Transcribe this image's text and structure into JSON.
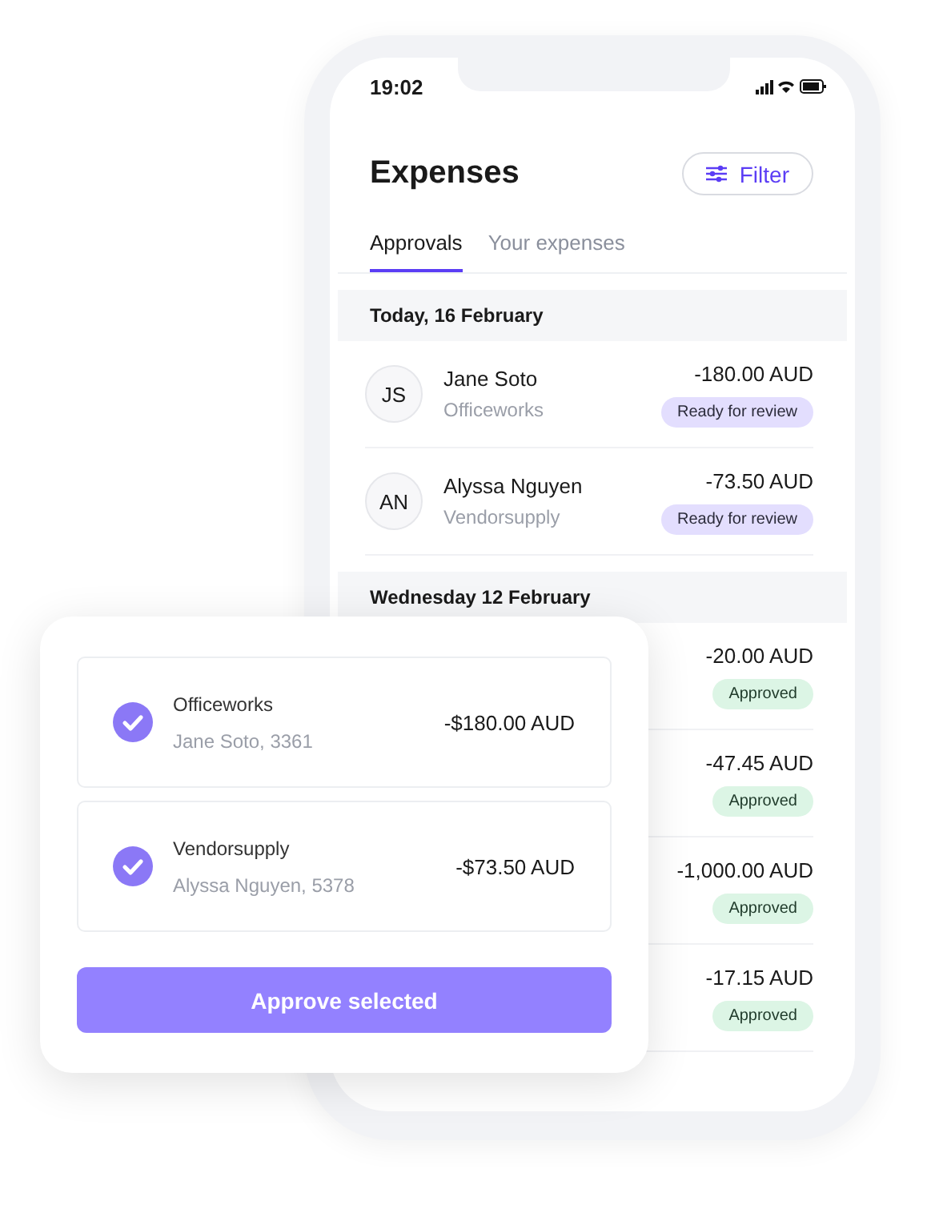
{
  "status_bar": {
    "time": "19:02"
  },
  "header": {
    "title": "Expenses",
    "filter_button": "Filter"
  },
  "tabs": [
    {
      "label": "Approvals",
      "selected": true
    },
    {
      "label": "Your expenses",
      "selected": false
    }
  ],
  "sections": [
    {
      "heading": "Today, 16 February",
      "rows": [
        {
          "initials": "JS",
          "name": "Jane Soto",
          "vendor": "Officeworks",
          "amount": "-180.00 AUD",
          "status": "Ready for review",
          "kind": "review"
        },
        {
          "initials": "AN",
          "name": "Alyssa Nguyen",
          "vendor": "Vendorsupply",
          "amount": "-73.50 AUD",
          "status": "Ready for review",
          "kind": "review"
        }
      ]
    },
    {
      "heading": "Wednesday 12 February",
      "rows": [
        {
          "amount": "-20.00 AUD",
          "status": "Approved",
          "kind": "approved"
        },
        {
          "amount": "-47.45 AUD",
          "status": "Approved",
          "kind": "approved"
        },
        {
          "amount": "-1,000.00 AUD",
          "status": "Approved",
          "kind": "approved"
        },
        {
          "amount": "-17.15 AUD",
          "status": "Approved",
          "kind": "approved"
        }
      ]
    }
  ],
  "approval_card": {
    "items": [
      {
        "vendor": "Officeworks",
        "detail": "Jane Soto, 3361",
        "amount": "-$180.00 AUD",
        "checked": true
      },
      {
        "vendor": "Vendorsupply",
        "detail": "Alyssa Nguyen, 5378",
        "amount": "-$73.50 AUD",
        "checked": true
      }
    ],
    "button": "Approve selected"
  }
}
